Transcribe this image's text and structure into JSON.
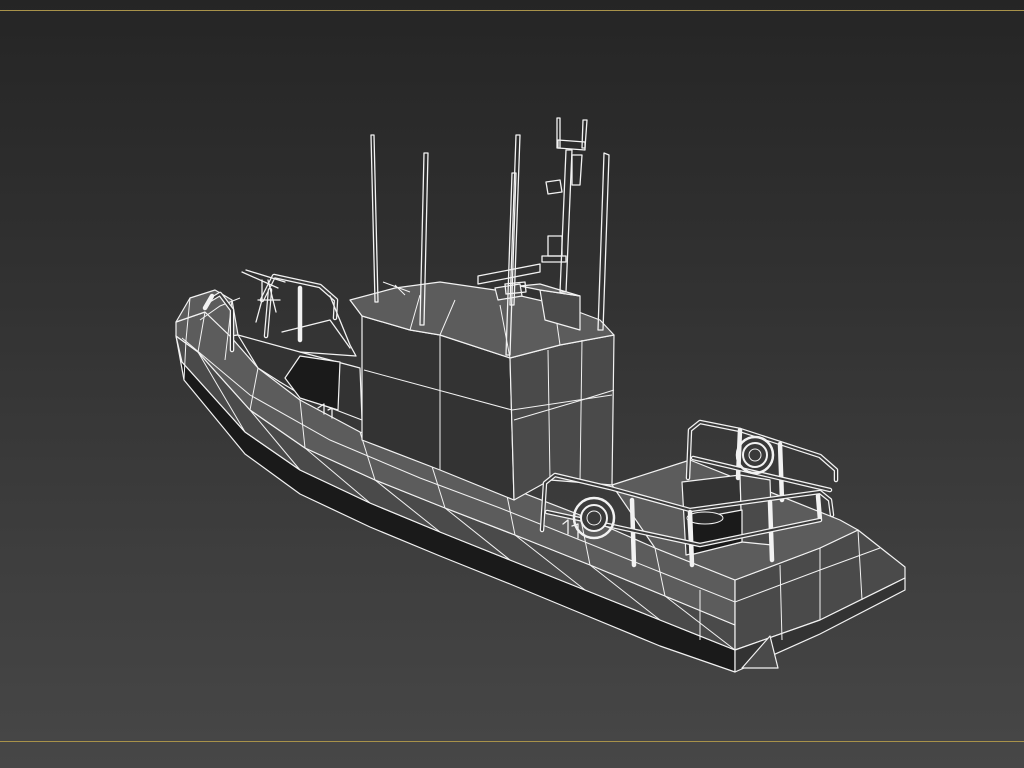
{
  "viewport": {
    "background_top": "#252525",
    "background_bottom": "#474747",
    "frame_color": "#a8924a",
    "wireframe_color": "#f2f2f2"
  },
  "model": {
    "subject": "rigid-inflatable-boat",
    "render_mode": "edged-faces"
  }
}
